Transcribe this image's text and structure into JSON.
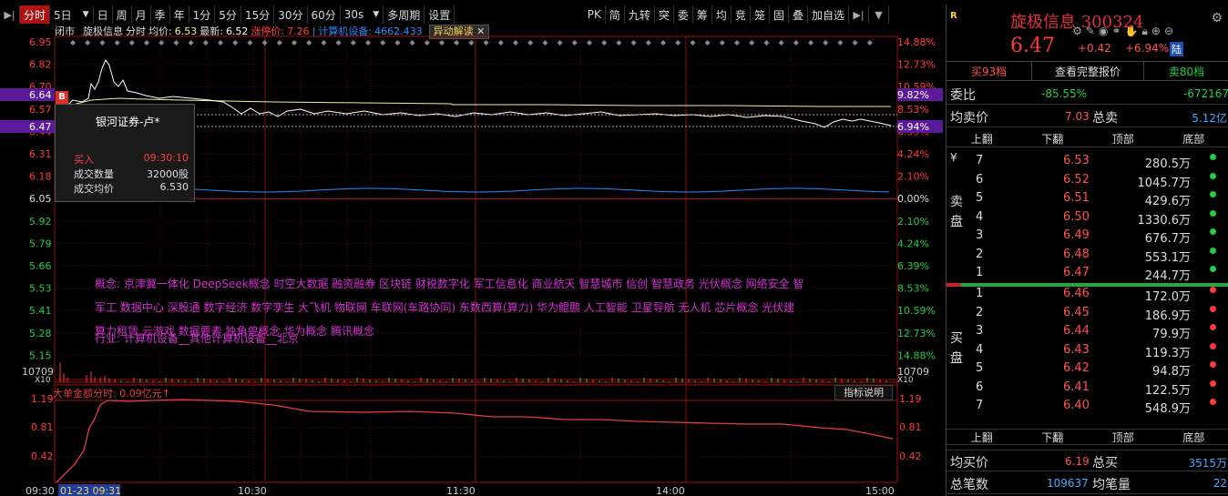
{
  "toolbar": {
    "left_items": [
      "分时",
      "5日",
      "日",
      "周",
      "月",
      "季",
      "年",
      "1分",
      "5分",
      "15分",
      "30分",
      "60分",
      "30s",
      "多周期",
      "设置"
    ],
    "right_items": [
      "PK",
      "简",
      "九转",
      "突",
      "委",
      "筹",
      "均",
      "竞",
      "笼",
      "固",
      "叠",
      "加自选"
    ],
    "active": "分时"
  },
  "info": {
    "market": "闭市",
    "name": "旋极信息",
    "mode": "分时",
    "avg_label": "均价:",
    "avg_value": "6.53",
    "last_label": "最新:",
    "last_value": "6.52",
    "limit_label": "涨停价:",
    "limit_value": "7.26",
    "sector_label": "计算机设备:",
    "sector_value": "4662.433",
    "tag": "异动解读"
  },
  "price_axis": {
    "left_labels": [
      "6.95",
      "6.82",
      "6.70",
      "6.57",
      "6.44",
      "6.31",
      "6.18",
      "6.05",
      "5.92",
      "5.79",
      "5.66",
      "5.53",
      "5.41",
      "5.28",
      "5.15"
    ],
    "right_labels": [
      "14.88%",
      "12.73%",
      "10.59%",
      "8.53%",
      "6.39%",
      "4.24%",
      "2.10%",
      "0.00%",
      "2.10%",
      "4.24%",
      "6.39%",
      "8.53%",
      "10.59%",
      "12.73%",
      "14.88%"
    ],
    "highlight_left": [
      "6.64",
      "6.47"
    ],
    "highlight_right": [
      "9.82%",
      "6.94%"
    ]
  },
  "volume": {
    "max_label": "10709",
    "scale": "X10"
  },
  "big_order": {
    "title": "大单金额分时: 0.09亿元↑",
    "button": "指标说明",
    "axis_labels": [
      "1.19",
      "0.81",
      "0.42"
    ]
  },
  "time_axis": [
    "09:30",
    "01-23 09:31",
    "10:30",
    "11:30",
    "14:00",
    "15:00"
  ],
  "tooltip": {
    "badge": "B",
    "title": "银河证券-卢*",
    "rows": [
      {
        "label": "买入",
        "value": "09:30:10"
      },
      {
        "label": "成交数量",
        "value": "32000股"
      },
      {
        "label": "成交均价",
        "value": "6.530"
      }
    ]
  },
  "concepts": {
    "lines": [
      "概念: 京津冀一体化  DeepSeek概念  时空大数据  融资融券  区块链  财税数字化  军工信息化  商业航天  智慧城市  信创  智慧政务  光伏概念  网络安全  智",
      "军工  数据中心  深股通  数字经济  数字孪生  大飞机  物联网  车联网(车路协同)  东数西算(算力)  华为鲲鹏  人工智能  卫星导航  无人机  芯片概念  光伏建",
      "算力租赁  云游戏  数据要素  独角兽概念  华为概念  腾讯概念"
    ],
    "industry": "行业: 计算机设备__其他计算机设备__北京"
  },
  "panel": {
    "logo": "R",
    "name": "旋极信息",
    "code": "300324",
    "price": "6.47",
    "change": "+0.42",
    "pct": "+6.94%",
    "market_badge": "陆",
    "btn_sell": "买93档",
    "btn_full": "查看完整报价",
    "btn_buy": "卖80档",
    "weibi_label": "委比",
    "weibi_value": "-85.55%",
    "weibi_diff": "-672167",
    "avg_sell_label": "均卖价",
    "avg_sell_value": "7.03",
    "total_sell_label": "总卖",
    "total_sell_value": "5.12亿",
    "headers": [
      "上翻",
      "下翻",
      "顶部",
      "底部"
    ],
    "sell_side_label": "卖盘",
    "buy_side_label": "买盘",
    "currency_symbol": "¥",
    "sells": [
      {
        "level": "7",
        "price": "6.53",
        "vol": "280.5万"
      },
      {
        "level": "6",
        "price": "6.52",
        "vol": "1045.7万"
      },
      {
        "level": "5",
        "price": "6.51",
        "vol": "429.6万"
      },
      {
        "level": "4",
        "price": "6.50",
        "vol": "1330.6万"
      },
      {
        "level": "3",
        "price": "6.49",
        "vol": "676.7万"
      },
      {
        "level": "2",
        "price": "6.48",
        "vol": "553.1万"
      },
      {
        "level": "1",
        "price": "6.47",
        "vol": "244.7万"
      }
    ],
    "buys": [
      {
        "level": "1",
        "price": "6.46",
        "vol": "172.0万"
      },
      {
        "level": "2",
        "price": "6.45",
        "vol": "186.9万"
      },
      {
        "level": "3",
        "price": "6.44",
        "vol": "79.9万"
      },
      {
        "level": "4",
        "price": "6.43",
        "vol": "119.3万"
      },
      {
        "level": "5",
        "price": "6.42",
        "vol": "94.8万"
      },
      {
        "level": "6",
        "price": "6.41",
        "vol": "122.5万"
      },
      {
        "level": "7",
        "price": "6.40",
        "vol": "548.9万"
      }
    ],
    "avg_buy_label": "均买价",
    "avg_buy_value": "6.19",
    "total_buy_label": "总买",
    "total_buy_value": "3515万",
    "total_trades_label": "总笔数",
    "total_trades_value": "109637",
    "avg_trade_label": "均笔量",
    "avg_trade_value": "22"
  },
  "colors": {
    "up": "#ff3a3a",
    "down": "#22cc44",
    "avg_line": "#f0f0a0",
    "price_line": "#ffffff",
    "volume_line": "#2a8aff",
    "big_order": "#e04040",
    "concept": "#d030d0",
    "highlight": "#5a1a9a"
  }
}
